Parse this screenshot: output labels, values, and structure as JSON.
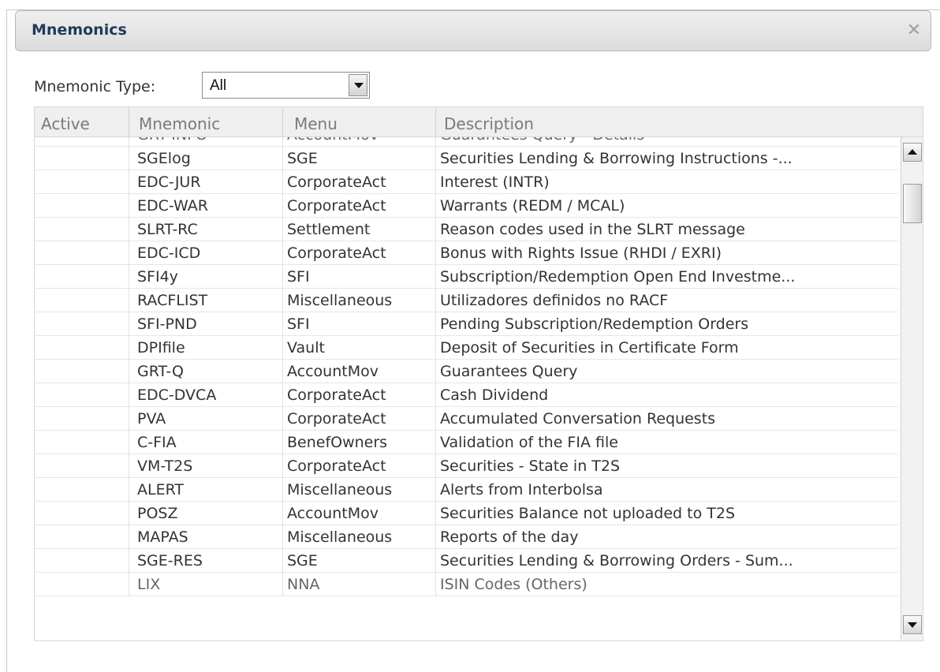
{
  "window": {
    "title": "Mnemonics",
    "close_icon": "close-icon"
  },
  "filter": {
    "label": "Mnemonic Type:",
    "selected": "All"
  },
  "table": {
    "columns": [
      "Active",
      "Mnemonic",
      "Menu",
      "Description"
    ],
    "partial_top": {
      "mnemonic": "GRT-INFO",
      "menu": "AccountMov",
      "description": "Guarantees Query - Details"
    },
    "rows": [
      {
        "mnemonic": "SGElog",
        "menu": "SGE",
        "description": "Securities Lending & Borrowing Instructions -..."
      },
      {
        "mnemonic": "EDC-JUR",
        "menu": "CorporateAct",
        "description": "Interest (INTR)"
      },
      {
        "mnemonic": "EDC-WAR",
        "menu": "CorporateAct",
        "description": "Warrants (REDM / MCAL)"
      },
      {
        "mnemonic": "SLRT-RC",
        "menu": "Settlement",
        "description": "Reason codes used in the SLRT message"
      },
      {
        "mnemonic": "EDC-ICD",
        "menu": "CorporateAct",
        "description": "Bonus with Rights Issue (RHDI / EXRI)"
      },
      {
        "mnemonic": "SFI4y",
        "menu": "SFI",
        "description": "Subscription/Redemption Open End Investme..."
      },
      {
        "mnemonic": "RACFLIST",
        "menu": "Miscellaneous",
        "description": "Utilizadores definidos no RACF"
      },
      {
        "mnemonic": "SFI-PND",
        "menu": "SFI",
        "description": "Pending Subscription/Redemption Orders"
      },
      {
        "mnemonic": "DPIfile",
        "menu": "Vault",
        "description": "Deposit of Securities in Certificate Form"
      },
      {
        "mnemonic": "GRT-Q",
        "menu": "AccountMov",
        "description": "Guarantees Query"
      },
      {
        "mnemonic": "EDC-DVCA",
        "menu": "CorporateAct",
        "description": "Cash Dividend"
      },
      {
        "mnemonic": "PVA",
        "menu": "CorporateAct",
        "description": "Accumulated Conversation Requests"
      },
      {
        "mnemonic": "C-FIA",
        "menu": "BenefOwners",
        "description": "Validation of the FIA file"
      },
      {
        "mnemonic": "VM-T2S",
        "menu": "CorporateAct",
        "description": "Securities - State in T2S"
      },
      {
        "mnemonic": "ALERT",
        "menu": "Miscellaneous",
        "description": "Alerts from Interbolsa"
      },
      {
        "mnemonic": "POSZ",
        "menu": "AccountMov",
        "description": "Securities Balance not uploaded to T2S"
      },
      {
        "mnemonic": "MAPAS",
        "menu": "Miscellaneous",
        "description": "Reports of the day"
      },
      {
        "mnemonic": "SGE-RES",
        "menu": "SGE",
        "description": "Securities Lending & Borrowing Orders - Sum..."
      }
    ],
    "partial_bottom": {
      "mnemonic": "LIX",
      "menu": "NNA",
      "description": "ISIN Codes (Others)"
    }
  },
  "icons": {
    "dropdown": "chevron-down-icon",
    "scroll_up": "arrow-up-icon",
    "scroll_down": "arrow-down-icon"
  }
}
